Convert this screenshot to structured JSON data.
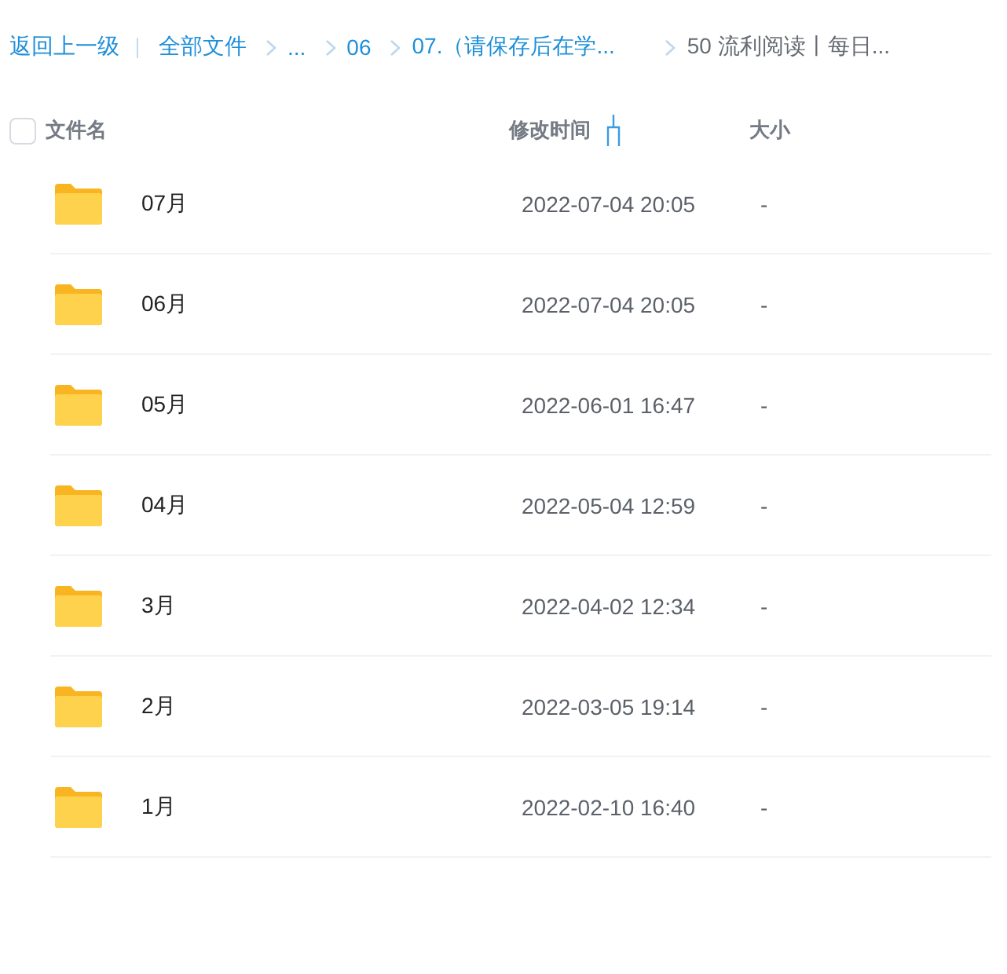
{
  "breadcrumb": {
    "back": "返回上一级",
    "items": [
      {
        "label": "全部文件",
        "kind": "link"
      },
      {
        "label": "...",
        "kind": "link"
      },
      {
        "label": "06",
        "kind": "link"
      },
      {
        "label": "07.（请保存后在学...",
        "kind": "link"
      },
      {
        "label": "50 流利阅读丨每日...",
        "kind": "current"
      }
    ]
  },
  "table": {
    "select_all": {
      "checked": false
    },
    "columns": [
      "文件名",
      "修改时间",
      "大小"
    ],
    "rows": [
      {
        "name": "07月",
        "modified": "2022-07-04 20:05",
        "size": "-"
      },
      {
        "name": "06月",
        "modified": "2022-07-04 20:05",
        "size": "-"
      },
      {
        "name": "05月",
        "modified": "2022-06-01 16:47",
        "size": "-"
      },
      {
        "name": "04月",
        "modified": "2022-05-04 12:59",
        "size": "-"
      },
      {
        "name": "3月",
        "modified": "2022-04-02 12:34",
        "size": "-"
      },
      {
        "name": "2月",
        "modified": "2022-03-05 19:14",
        "size": "-"
      },
      {
        "name": "1月",
        "modified": "2022-02-10 16:40",
        "size": "-"
      }
    ]
  }
}
